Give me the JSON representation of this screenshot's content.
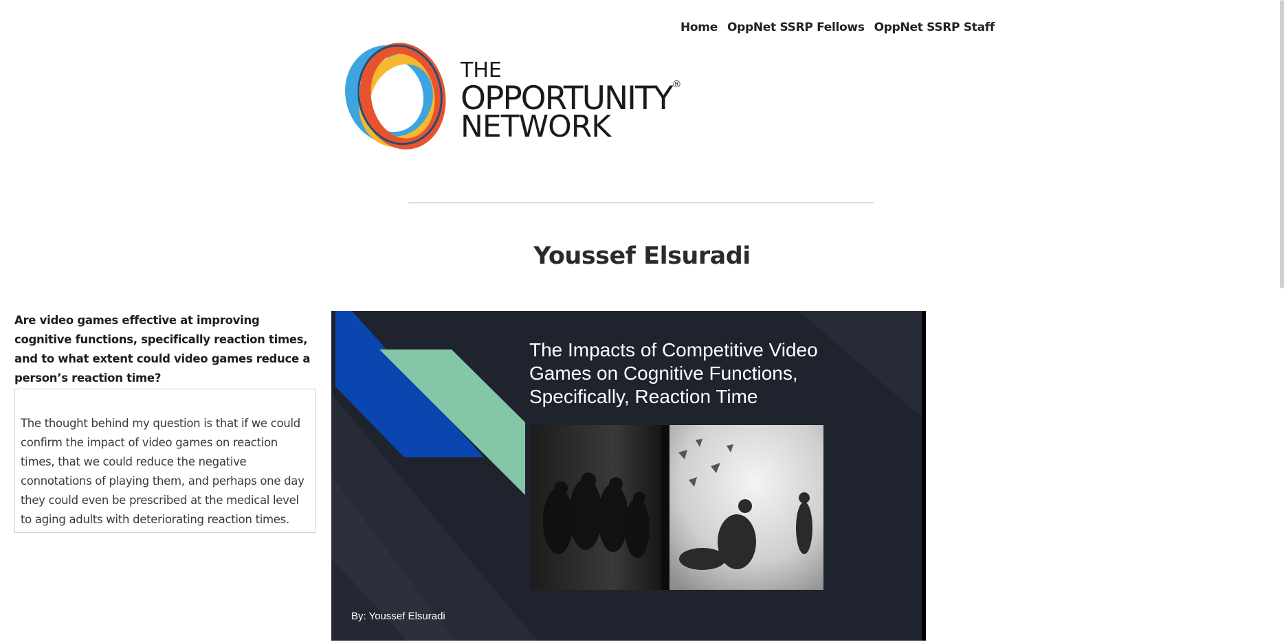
{
  "nav": {
    "items": [
      {
        "label": "Home"
      },
      {
        "label": "OppNet SSRP Fellows"
      },
      {
        "label": "OppNet SSRP Staff"
      }
    ]
  },
  "logo": {
    "line1": "THE",
    "line2": "OPPORTUNITY",
    "registered": "®",
    "line3": "NETWORK",
    "colors": {
      "blue": "#3da4e0",
      "yellow": "#f5b82e",
      "red": "#e8532f",
      "navy": "#1f4e79"
    }
  },
  "page": {
    "title": "Youssef Elsuradi"
  },
  "research": {
    "question": "Are video games effective at improving cognitive functions, specifically reaction times, and to what extent could video games reduce a person’s reaction time?",
    "rationale": "The thought behind my question is that if we could confirm the impact of video games on reaction times, that we could reduce the negative connotations of playing them, and perhaps one day they could even be prescribed at the medical level to aging adults with deteriorating reaction times."
  },
  "slide": {
    "title": "The Impacts of Competitive Video Games on Cognitive Functions, Specifically, Reaction Time",
    "byline": "By: Youssef Elsuradi",
    "colors": {
      "background": "#1f232d",
      "blue": "#0a46b0",
      "green": "#84c6a6"
    }
  }
}
